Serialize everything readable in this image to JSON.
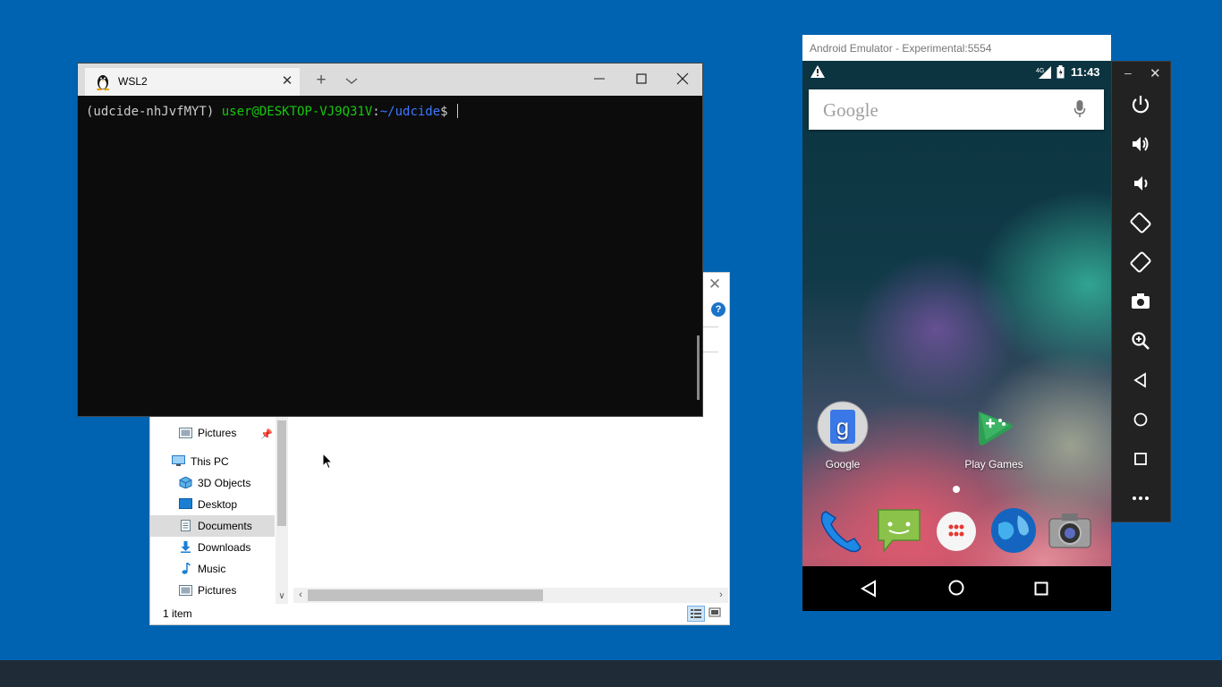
{
  "explorer": {
    "nav_items": [
      {
        "label": "Pictures",
        "icon": "pictures-icon",
        "pinned": true
      },
      {
        "label": "This PC",
        "icon": "computer-icon"
      },
      {
        "label": "3D Objects",
        "icon": "3d-objects-icon"
      },
      {
        "label": "Desktop",
        "icon": "desktop-icon"
      },
      {
        "label": "Documents",
        "icon": "documents-icon",
        "selected": true
      },
      {
        "label": "Downloads",
        "icon": "downloads-icon"
      },
      {
        "label": "Music",
        "icon": "music-icon"
      },
      {
        "label": "Pictures",
        "icon": "pictures-icon"
      }
    ],
    "status_text": "1 item",
    "help_glyph": "?"
  },
  "terminal": {
    "tab_title": "WSL2",
    "prompt_env": "(udcide-nhJvfMYT) ",
    "prompt_user": "user@DESKTOP-VJ9Q31V",
    "prompt_colon": ":",
    "prompt_path": "~/udcide",
    "prompt_symbol": "$ "
  },
  "emulator": {
    "window_title": "Android Emulator - Experimental:5554",
    "status_time": "11:43",
    "network_label": "4G",
    "search_placeholder": "Google",
    "apps": [
      {
        "label": "Google",
        "icon": "google-app-icon"
      },
      {
        "label": "Play Games",
        "icon": "play-games-icon"
      }
    ],
    "dock": [
      "phone-icon",
      "messaging-icon",
      "app-drawer-icon",
      "browser-icon",
      "camera-icon"
    ],
    "side_controls": [
      "power",
      "volume-up",
      "volume-down",
      "rotate-left",
      "rotate-right",
      "screenshot",
      "zoom",
      "back",
      "home",
      "overview",
      "more"
    ]
  },
  "colors": {
    "desktop_bg": "#0063b1",
    "terminal_bg": "#0c0c0c",
    "prompt_user": "#16c60c",
    "prompt_path": "#3b78ff",
    "emulator_toolbar": "#222222"
  }
}
